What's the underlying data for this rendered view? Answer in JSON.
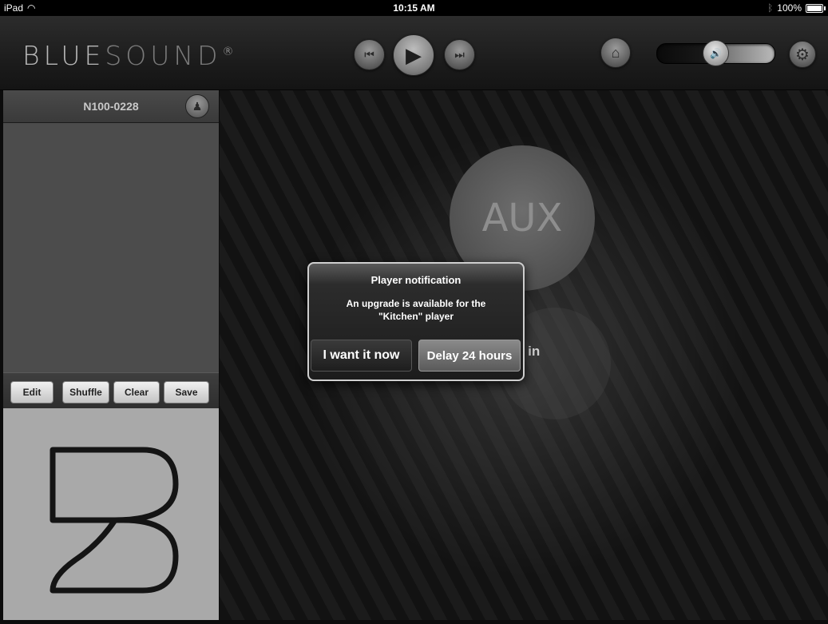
{
  "status_bar": {
    "device": "iPad",
    "time": "10:15 AM",
    "battery": "100%"
  },
  "header": {
    "brand_main": "BLUE",
    "brand_dim": "SOUND",
    "brand_mark": "®",
    "volume_level": 0.6
  },
  "icons": {
    "prev": "⏮",
    "play": "▶",
    "next": "⏭",
    "home": "⌂",
    "settings": "⚙",
    "volume": "🔊",
    "player": "♟",
    "wifi": "◠",
    "bluetooth": "ᛒ"
  },
  "sidebar": {
    "player_name": "N100-0228",
    "queue_buttons": [
      "Edit",
      "Shuffle",
      "Clear",
      "Save"
    ]
  },
  "main": {
    "source_circle": "AUX",
    "source_label": "x in"
  },
  "dialog": {
    "title": "Player notification",
    "message_line1": "An upgrade is available for the",
    "message_line2": "\"Kitchen\" player",
    "button_now": "I want it now",
    "button_delay": "Delay 24 hours"
  },
  "colors": {
    "background": "#0c0c0c",
    "panel": "#4c4c4c",
    "album_art": "#a9a9a9"
  }
}
